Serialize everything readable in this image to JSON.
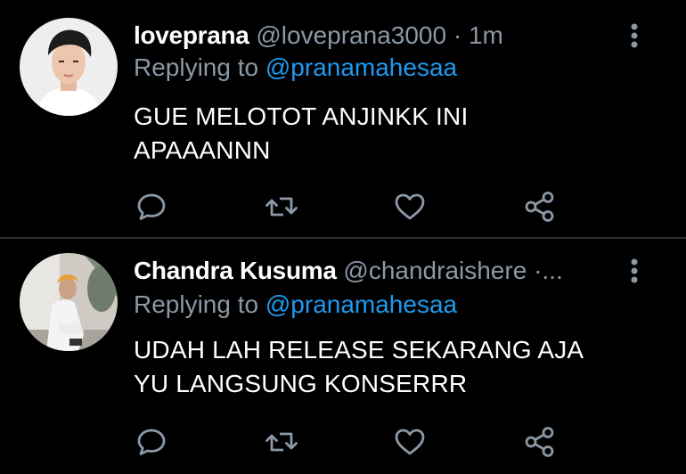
{
  "tweets": [
    {
      "name": "loveprana",
      "handle": "@loveprana3000",
      "separator": "·",
      "time": "1m",
      "replying_prefix": "Replying to",
      "replying_to": "@pranamahesaa",
      "text_line1": "GUE MELOTOT ANJINKK INI",
      "text_line2": "APAAANNN"
    },
    {
      "name": "Chandra Kusuma",
      "handle": "@chandraishere",
      "separator": "·...",
      "time": "",
      "replying_prefix": "Replying to",
      "replying_to": "@pranamahesaa",
      "text_line1": "UDAH LAH RELEASE SEKARANG AJA",
      "text_line2": "YU LANGSUNG KONSERRR"
    }
  ],
  "icons": {
    "reply": "reply-icon",
    "retweet": "retweet-icon",
    "like": "heart-icon",
    "share": "share-icon",
    "more": "more-vertical-icon"
  },
  "colors": {
    "background": "#000000",
    "text": "#ffffff",
    "secondary": "#8b98a5",
    "accent": "#1d9bf0",
    "divider": "#2f3336"
  }
}
